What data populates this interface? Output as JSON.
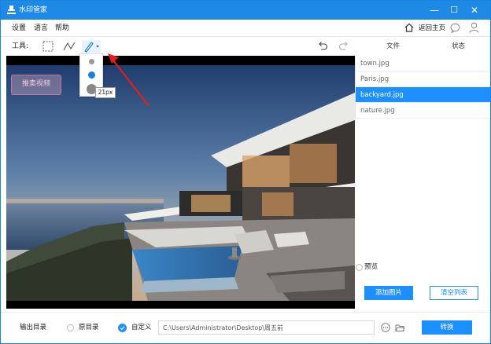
{
  "window": {
    "title": "水印管家",
    "min": "—",
    "max": "☐",
    "close": "✕"
  },
  "menu": {
    "items": [
      "设置",
      "语言",
      "帮助"
    ],
    "home_label": "返回主页"
  },
  "toolbar": {
    "label": "工具:",
    "col_file": "文件",
    "col_status": "状态"
  },
  "canvas": {
    "watermark_text": "推卖视频"
  },
  "pen_dropdown": {
    "size_tooltip": "21px",
    "dot_colors": [
      "#999999",
      "#1e7fd6",
      "#888888"
    ]
  },
  "files": [
    {
      "name": "town.jpg",
      "selected": false
    },
    {
      "name": "Paris.jpg",
      "selected": false
    },
    {
      "name": "backyard.jpg",
      "selected": true
    },
    {
      "name": "nature.jpg",
      "selected": false
    }
  ],
  "preview_label": "预览",
  "buttons": {
    "add_image": "添加图片",
    "clear_list": "清空列表",
    "convert": "转换"
  },
  "output": {
    "label": "输出目录",
    "option_original": "原目录",
    "option_custom": "自定义",
    "path": "C:\\Users\\Administrator\\Desktop\\周五前"
  },
  "colors": {
    "accent": "#1e8fff",
    "titlebar": "#1f8ae6",
    "annotation_arrow": "#e0201c"
  }
}
